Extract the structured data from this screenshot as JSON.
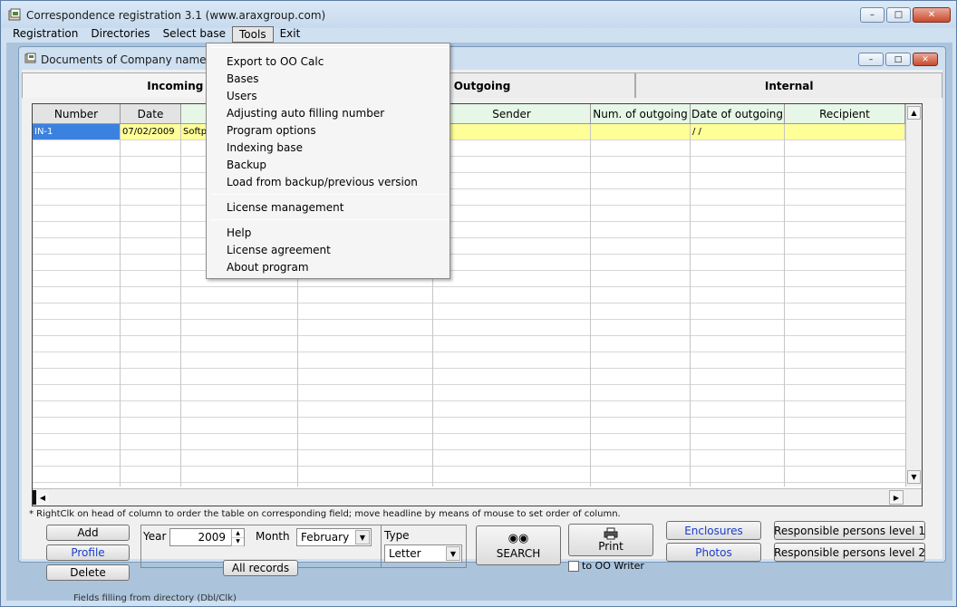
{
  "window": {
    "title": "Correspondence registration 3.1 (www.araxgroup.com)",
    "buttons": [
      "minimize",
      "maximize",
      "close"
    ]
  },
  "menubar": {
    "items": [
      "Registration",
      "Directories",
      "Select base",
      "Tools",
      "Exit"
    ],
    "active": "Tools"
  },
  "tools_menu": {
    "group1": [
      "Export to OO Calc",
      "Bases",
      "Users",
      "Adjusting auto filling number",
      "Program options",
      "Indexing base",
      "Backup",
      "Load from backup/previous version"
    ],
    "group2": [
      "License management"
    ],
    "group3": [
      "Help",
      "License agreement",
      "About program"
    ]
  },
  "document": {
    "title": "Documents of Company name",
    "tabs": [
      "Incoming",
      "Outgoing",
      "Internal"
    ],
    "selected_tab": "Incoming"
  },
  "grid": {
    "columns": [
      "Number",
      "Date",
      "",
      "",
      "Sender",
      "Num. of outgoing",
      "Date of outgoing",
      "Recipient"
    ],
    "rows": [
      {
        "number": "IN-1",
        "date": "07/02/2009",
        "c3": "Softp",
        "c4": "",
        "sender": "",
        "num_outgoing": "",
        "date_outgoing": "/ /",
        "recipient": ""
      }
    ]
  },
  "hint": "* RightClk on head of column to order the table on corresponding field;  move  headline by means of mouse to set order of column.",
  "controls": {
    "add": "Add",
    "profile": "Profile",
    "delete": "Delete",
    "year_label": "Year",
    "year_value": "2009",
    "month_label": "Month",
    "month_value": "February",
    "type_label": "Type",
    "type_value": "Letter",
    "all_records": "All records",
    "search": "SEARCH",
    "print": "Print",
    "to_oo_writer": "to OO Writer",
    "enclosures": "Enclosures",
    "photos": "Photos",
    "resp1": "Responsible persons level 1",
    "resp2": "Responsible persons level 2"
  },
  "status": "Fields filling from directory (Dbl/Clk)"
}
